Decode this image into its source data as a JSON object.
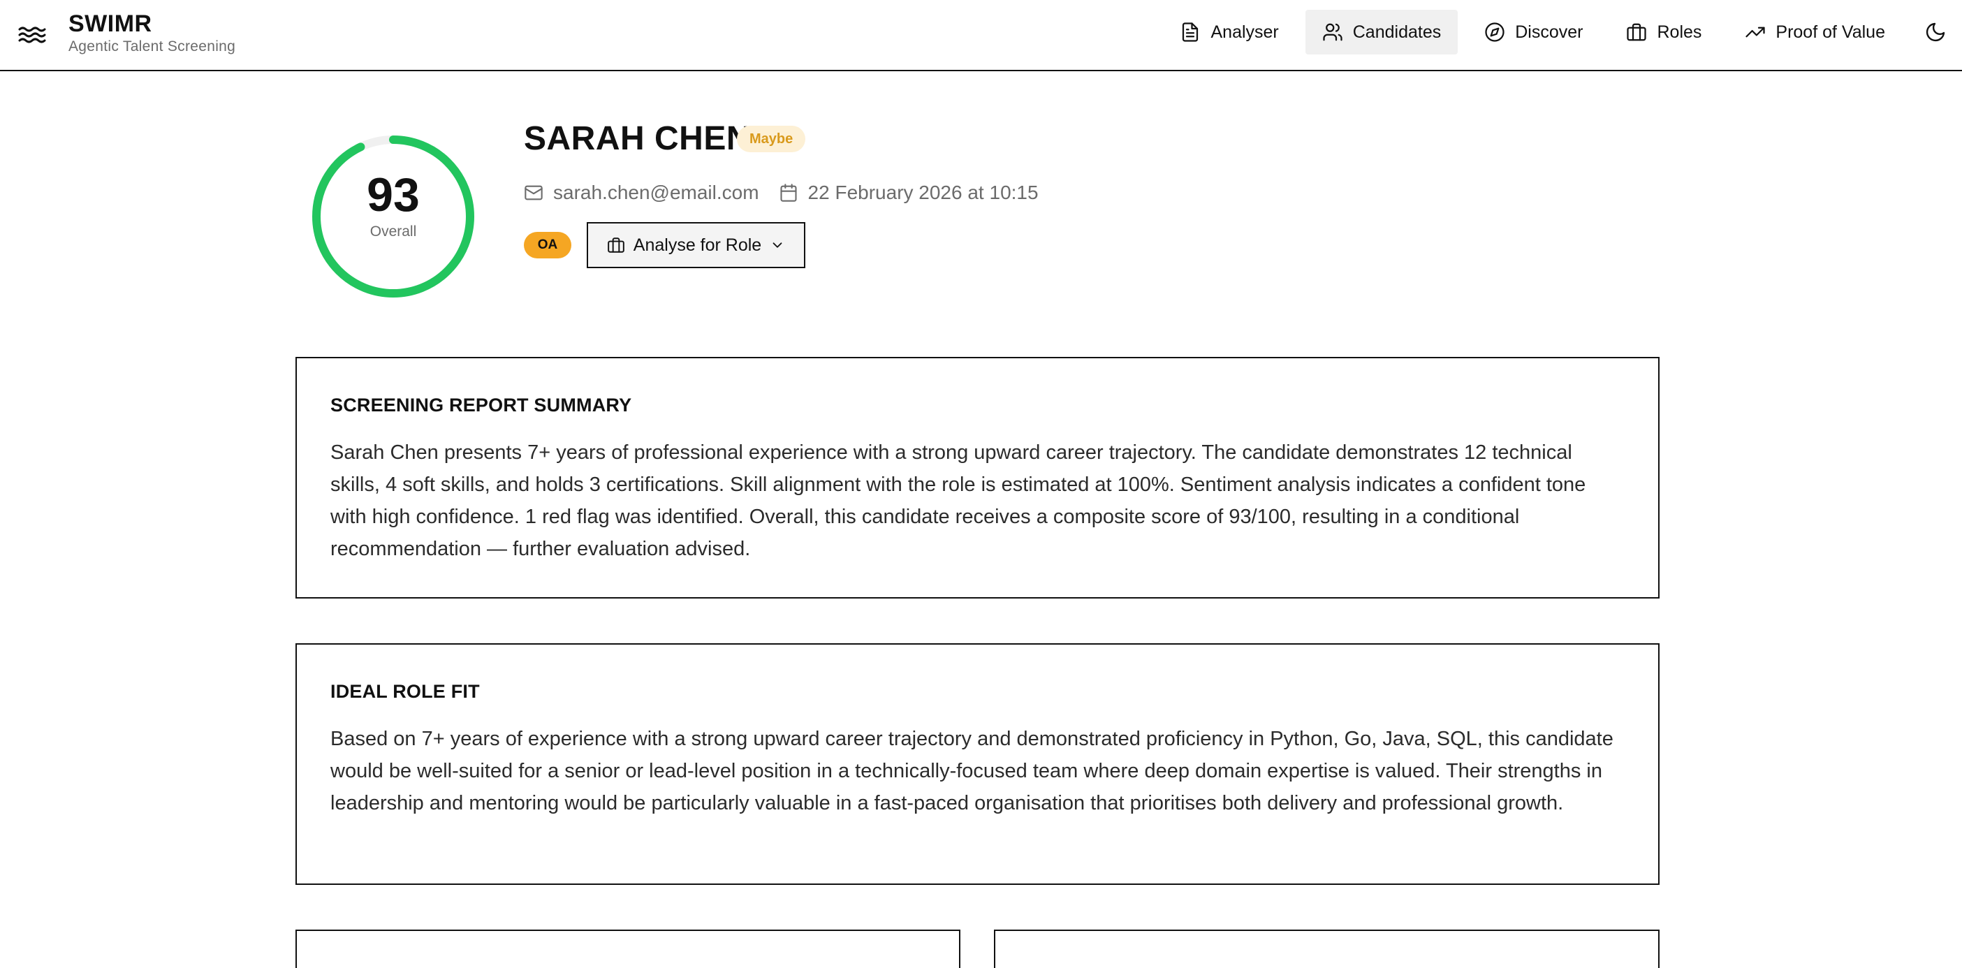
{
  "app": {
    "title": "SWIMR",
    "subtitle": "Agentic Talent Screening"
  },
  "nav": {
    "items": [
      {
        "label": "Analyser",
        "icon": "file-text-icon"
      },
      {
        "label": "Candidates",
        "icon": "users-icon",
        "active": true
      },
      {
        "label": "Discover",
        "icon": "compass-icon"
      },
      {
        "label": "Roles",
        "icon": "briefcase-icon"
      },
      {
        "label": "Proof of Value",
        "icon": "trending-up-icon"
      }
    ],
    "theme_toggle_icon": "moon-icon"
  },
  "candidate": {
    "name": "SARAH CHEN",
    "verdict": "Maybe",
    "email": "sarah.chen@email.com",
    "date": "22 February 2026 at 10:15",
    "tag": "OA",
    "score": "93",
    "score_fraction": 0.93,
    "score_label": "Overall",
    "analyse_button": "Analyse for Role"
  },
  "summary": {
    "heading": "SCREENING REPORT SUMMARY",
    "body": "Sarah Chen presents 7+ years of professional experience with a strong upward career trajectory. The candidate demonstrates 12 technical skills, 4 soft skills, and holds 3 certifications. Skill alignment with the role is estimated at 100%. Sentiment analysis indicates a confident tone with high confidence. 1 red flag was identified. Overall, this candidate receives a composite score of 93/100, resulting in a conditional recommendation — further evaluation advised."
  },
  "role_fit": {
    "heading": "IDEAL ROLE FIT",
    "body": "Based on 7+ years of experience with a strong upward career trajectory and demonstrated proficiency in Python, Go, Java, SQL, this candidate would be well-suited for a senior or lead-level position in a technically-focused team where deep domain expertise is valued. Their strengths in leadership and mentoring would be particularly valuable in a fast-paced organisation that prioritises both delivery and professional growth."
  },
  "colors": {
    "ring": "#22c55e",
    "ring_track": "#f0f0f0",
    "maybe_bg": "#fdf0d5",
    "maybe_text": "#d99a1c",
    "oa_bg": "#f5a623"
  }
}
